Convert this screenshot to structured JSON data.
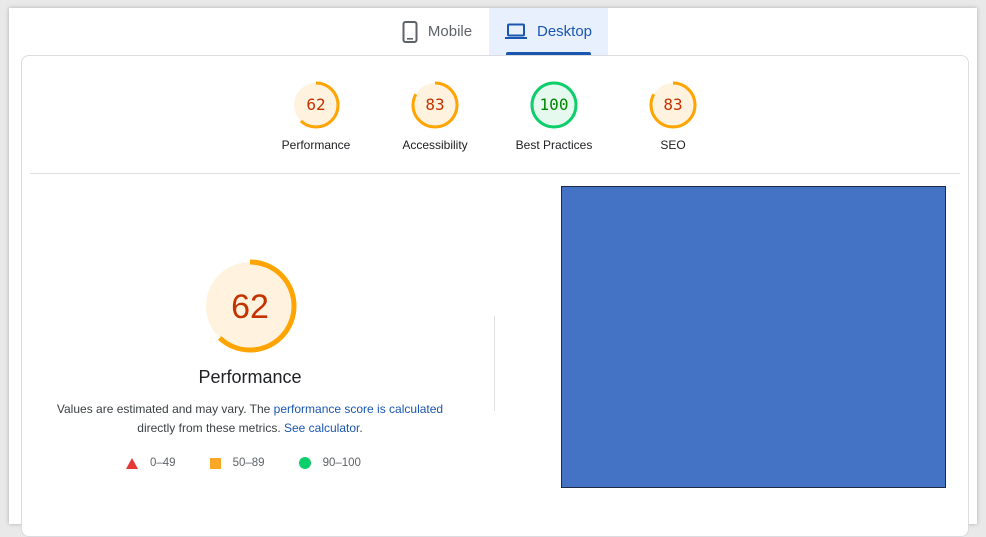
{
  "tabs": [
    {
      "label": "Mobile",
      "icon": "phone-icon",
      "active": false
    },
    {
      "label": "Desktop",
      "icon": "laptop-icon",
      "active": true
    }
  ],
  "categories": [
    {
      "label": "Performance",
      "score": "62",
      "level": 0.62,
      "status": "average"
    },
    {
      "label": "Accessibility",
      "score": "83",
      "level": 0.83,
      "status": "average"
    },
    {
      "label": "Best Practices",
      "score": "100",
      "level": 1.0,
      "status": "pass"
    },
    {
      "label": "SEO",
      "score": "83",
      "level": 0.83,
      "status": "average"
    }
  ],
  "main": {
    "score": "62",
    "level": 0.62,
    "title": "Performance",
    "desc_1": "Values are estimated and may vary. The ",
    "desc_link_1": "performance score is calculated",
    "desc_2": "directly from these metrics. ",
    "desc_link_2": "See calculator",
    "desc_3": "."
  },
  "legend": [
    {
      "range": "0–49",
      "shape": "triangle",
      "color": "#e53935"
    },
    {
      "range": "50–89",
      "shape": "square",
      "color": "#f9a825"
    },
    {
      "range": "90–100",
      "shape": "circle",
      "color": "#0cce6b"
    }
  ],
  "colors": {
    "average_stroke": "#ffa400",
    "average_fill": "#fff3e0",
    "average_text": "#c33300",
    "pass_stroke": "#0cce6b",
    "pass_fill": "#e6f9ef",
    "pass_text": "#008800",
    "accent": "#1a56b0",
    "screenshot": "#4472c4"
  }
}
